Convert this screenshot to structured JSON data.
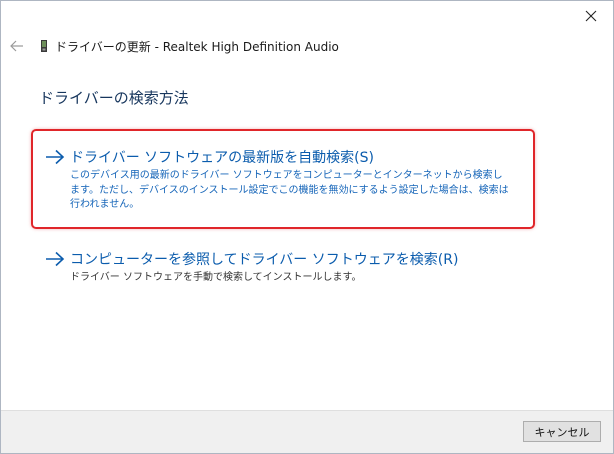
{
  "window": {
    "title": "ドライバーの更新 - Realtek High Definition Audio"
  },
  "page": {
    "heading": "ドライバーの検索方法"
  },
  "options": [
    {
      "title": "ドライバー ソフトウェアの最新版を自動検索(S)",
      "description": "このデバイス用の最新のドライバー ソフトウェアをコンピューターとインターネットから検索します。ただし、デバイスのインストール設定でこの機能を無効にするよう設定した場合は、検索は行われません。",
      "highlighted": true
    },
    {
      "title": "コンピューターを参照してドライバー ソフトウェアを検索(R)",
      "description": "ドライバー ソフトウェアを手動で検索してインストールします。",
      "highlighted": false
    }
  ],
  "footer": {
    "cancel_label": "キャンセル"
  },
  "icons": {
    "close": "close-icon",
    "back": "back-arrow-icon",
    "device": "audio-device-icon",
    "option_arrow": "arrow-right-icon"
  },
  "colors": {
    "link": "#0b5cad",
    "highlight_border": "#e0262a",
    "footer_bg": "#f0f0f0"
  }
}
